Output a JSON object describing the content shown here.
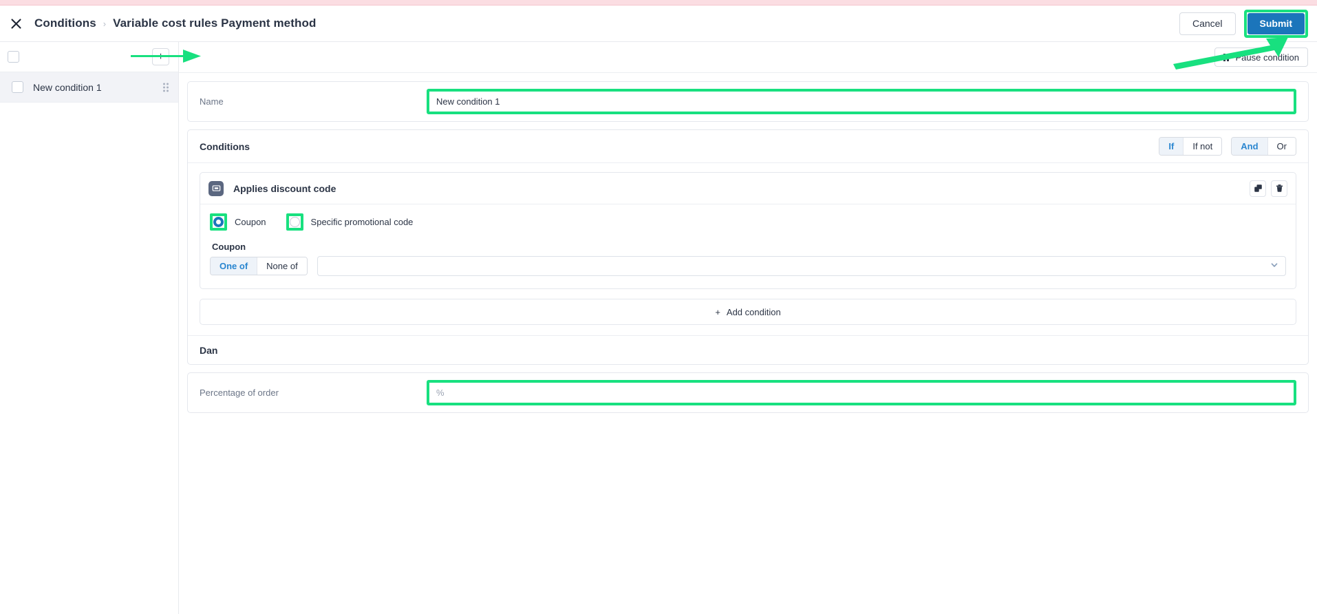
{
  "header": {
    "close_icon": "close-icon",
    "breadcrumb": [
      "Conditions",
      "Variable cost rules Payment method"
    ],
    "separator": "›",
    "cancel_label": "Cancel",
    "submit_label": "Submit"
  },
  "sidebar": {
    "add_button_label": "+",
    "rows": [
      {
        "label": "New condition 1",
        "selected": true
      }
    ]
  },
  "main_toolbar": {
    "pause_label": "Pause condition"
  },
  "name_field": {
    "label": "Name",
    "value": "New condition 1",
    "placeholder": ""
  },
  "conditions": {
    "title": "Conditions",
    "logic_group": [
      {
        "label": "If",
        "active": true
      },
      {
        "label": "If not",
        "active": false
      }
    ],
    "join_group": [
      {
        "label": "And",
        "active": true
      },
      {
        "label": "Or",
        "active": false
      }
    ],
    "cards": [
      {
        "icon": "discount-card-icon",
        "name": "Applies discount code",
        "duplicate_icon": "duplicate-icon",
        "delete_icon": "trash-icon",
        "radios": [
          {
            "label": "Coupon",
            "checked": true
          },
          {
            "label": "Specific promotional code",
            "checked": false
          }
        ],
        "sub_label": "Coupon",
        "match_group": [
          {
            "label": "One of",
            "active": true
          },
          {
            "label": "None of",
            "active": false
          }
        ],
        "select_value": "",
        "select_placeholder": "",
        "chevron_icon": "chevron-down-icon"
      }
    ],
    "add_condition_label": "Add condition",
    "add_condition_plus": "+"
  },
  "action_section": {
    "title": "Dan",
    "percentage_field": {
      "label": "Percentage of order",
      "value": "",
      "placeholder": "%"
    }
  },
  "colors": {
    "accent_blue": "#1b75bb",
    "highlight_green": "#18e07f",
    "banner_pink": "#fbdde2",
    "icon_slate": "#5b6780"
  }
}
